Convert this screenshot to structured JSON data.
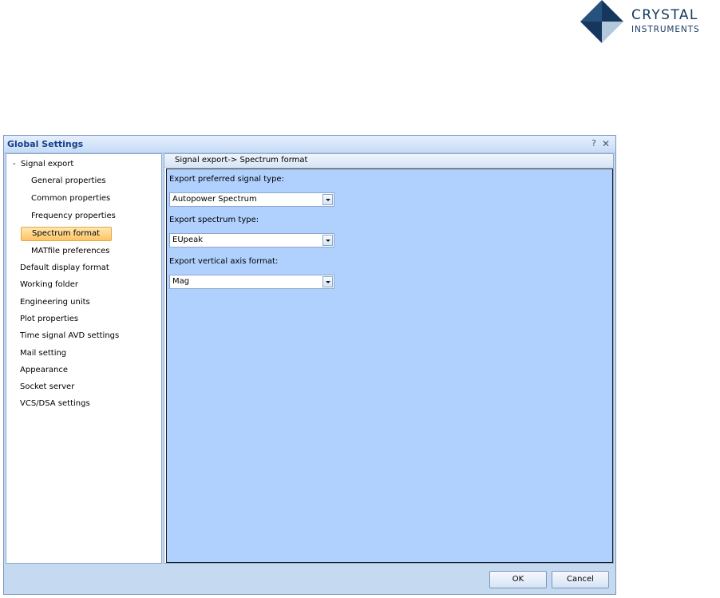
{
  "logo": {
    "line1": "CRYSTAL",
    "line2": "INSTRUMENTS",
    "colors": {
      "dark": "#15375e",
      "light": "#b4c8dc"
    }
  },
  "dialog": {
    "title": "Global Settings",
    "help_label": "?",
    "close_label": "✕",
    "nav": {
      "group_toggle": "-",
      "group_label": "Signal export",
      "sub_items": [
        "General properties",
        "Common properties",
        "Frequency properties",
        "Spectrum format",
        "MATfile preferences"
      ],
      "selected": "Spectrum format",
      "items": [
        "Default display format",
        "Working folder",
        "Engineering units",
        "Plot properties",
        "Time signal AVD settings",
        "Mail setting",
        "Appearance",
        "Socket server",
        "VCS/DSA settings"
      ]
    },
    "panel": {
      "header": "Signal export-> Spectrum format",
      "fields": [
        {
          "label": "Export preferred signal type:",
          "value": "Autopower Spectrum"
        },
        {
          "label": "Export spectrum type:",
          "value": "EUpeak"
        },
        {
          "label": "Export vertical axis format:",
          "value": "Mag"
        }
      ]
    },
    "buttons": {
      "ok": "OK",
      "cancel": "Cancel"
    },
    "colors": {
      "panel_background": "#b0d0fe",
      "title_text": "#15428b",
      "selected_item": "#ffc265"
    }
  }
}
